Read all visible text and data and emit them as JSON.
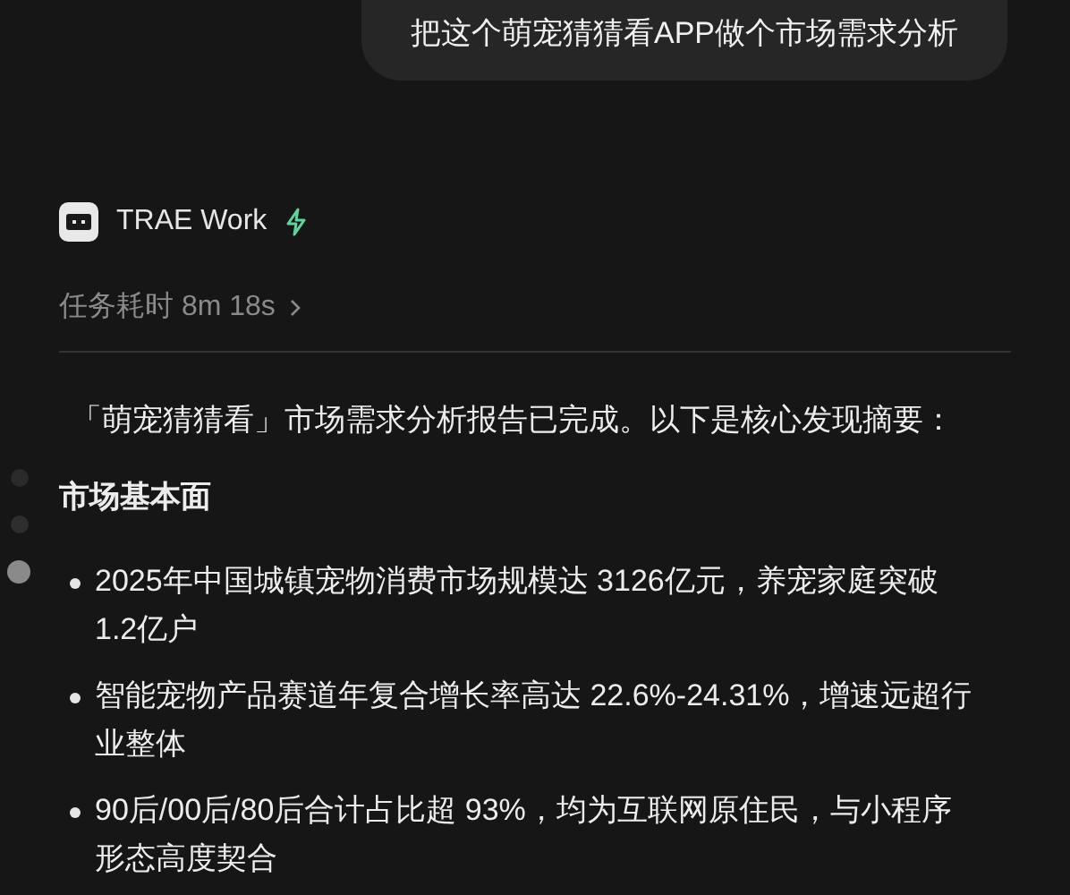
{
  "user_message": "把这个萌宠猜猜看APP做个市场需求分析",
  "agent": {
    "name": "TRAE Work"
  },
  "task_time": "任务耗时 8m 18s",
  "summary": "「萌宠猜猜看」市场需求分析报告已完成。以下是核心发现摘要：",
  "section_title": "市场基本面",
  "bullets": [
    "2025年中国城镇宠物消费市场规模达 3126亿元，养宠家庭突破 1.2亿户",
    "智能宠物产品赛道年复合增长率高达 22.6%-24.31%，增速远超行业整体",
    "90后/00后/80后合计占比超 93%，均为互联网原住民，与小程序形态高度契合"
  ]
}
